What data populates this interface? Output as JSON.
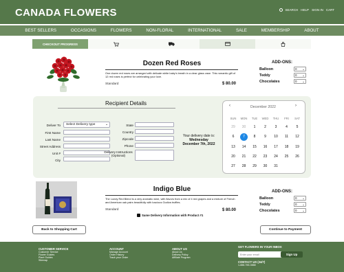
{
  "header": {
    "logo": "CANADA FLOWERS",
    "links": [
      "SEARCH",
      "HELP",
      "SIGN IN",
      "CART"
    ]
  },
  "nav": [
    "BEST SELLERS",
    "OCCASIONS",
    "FLOWERS",
    "NON-FLORAL",
    "INTERNATIONAL",
    "SALE",
    "MEMBERSHIP",
    "ABOUT"
  ],
  "progress": {
    "label": "CHECKOUT PROGRESS",
    "icons": [
      "cart-icon",
      "truck-icon",
      "card-icon",
      "bag-icon"
    ]
  },
  "product1": {
    "name": "Dozen Red Roses",
    "description": "One dozen red roses are arranged with delicate white baby's breath in a clear glass vase. This romantic gift of 12 red roses is perfect for celebrating your love.",
    "size": "Standard",
    "price": "$ 80.00",
    "addons_title": "ADD-ONS:",
    "addons": [
      {
        "label": "Balloon",
        "value": "0"
      },
      {
        "label": "Teddy",
        "value": "0"
      },
      {
        "label": "Chocolates",
        "value": "0"
      }
    ]
  },
  "recipient": {
    "title": "Recipient Details",
    "left_fields": {
      "deliver_to_label": "Deliver To",
      "deliver_to_value": "Select Delivery type",
      "first_name": "First Name",
      "last_name": "Last Name",
      "street": "Street Address",
      "unit": "Unit #",
      "city": "City"
    },
    "right_fields": {
      "state": "State",
      "country": "Country",
      "zipcode": "Zipcode",
      "phone": "Phone",
      "instructions": "Delivery Instructions (Optional)"
    },
    "delivery_label": "Your delivery date is:",
    "delivery_day": "Wednesday",
    "delivery_date": "December 7th, 2022"
  },
  "calendar": {
    "month": "December 2022",
    "prev": "‹",
    "next": "›",
    "days": [
      "SUN",
      "MON",
      "TUE",
      "WED",
      "THU",
      "FRI",
      "SAT"
    ],
    "weeks": [
      [
        "29",
        "30",
        "1",
        "2",
        "3",
        "4",
        "5"
      ],
      [
        "6",
        "7",
        "8",
        "9",
        "10",
        "11",
        "12"
      ],
      [
        "13",
        "14",
        "15",
        "16",
        "17",
        "18",
        "19"
      ],
      [
        "20",
        "21",
        "22",
        "23",
        "24",
        "25",
        "26"
      ],
      [
        "27",
        "28",
        "29",
        "30",
        "31",
        "",
        ""
      ]
    ]
  },
  "calendar_display": {
    "weeks": [
      [
        "29",
        "30",
        "1",
        "2",
        "3",
        "4",
        "5"
      ],
      [
        "6",
        "7",
        "8",
        "9",
        "10",
        "11",
        "12"
      ],
      [
        "13",
        "14",
        "15",
        "16",
        "17",
        "18",
        "19"
      ],
      [
        "20",
        "21",
        "22",
        "23",
        "24",
        "25",
        "26"
      ],
      [
        "27",
        "28",
        "29",
        "30",
        "31",
        "",
        ""
      ]
    ],
    "dim_first_row": 2,
    "selected": "7"
  },
  "product2": {
    "name": "Indigo Blue",
    "description": "The Lundy Red Blend is a very aromatic wine, with flavors from a mix of 4 red grapes and a mixture of French and American oak pairs beautifully with luscious Godiva truffles.",
    "size": "Standard",
    "price": "$ 80.00",
    "same_delivery": "Same Delivery Information with Product #1",
    "addons_title": "ADD-ONS:",
    "addons": [
      {
        "label": "Balloon",
        "value": "0"
      },
      {
        "label": "Teddy",
        "value": "0"
      },
      {
        "label": "Chocolates",
        "value": "0"
      }
    ]
  },
  "buttons": {
    "back": "Back to Shopping Cart",
    "continue": "Continue to Payment"
  },
  "footer": {
    "customer_service": {
      "title": "CUSTOMER SERVICE",
      "items": [
        "Customer Service",
        "Flower Guides",
        "Plant Guides",
        "Sitemap"
      ]
    },
    "account": {
      "title": "ACCOUNT",
      "items": [
        "Manage Account",
        "Order History",
        "Track your Order"
      ]
    },
    "about": {
      "title": "ABOUT US",
      "items": [
        "About Us",
        "Delivery Policy",
        "Affiliate Program"
      ]
    },
    "newsletter": {
      "title": "GET FLOWERS IN YOUR INBOX",
      "placeholder": "Enter your email",
      "button": "Sign Up"
    },
    "contact": {
      "title": "CONTACT US (24/7)",
      "phone": "1-888-755-0888"
    }
  },
  "colors": {
    "header": "#55784a",
    "nav": "#6d8b60",
    "panel": "#eef3ea",
    "selected_date": "#1e88e5"
  }
}
